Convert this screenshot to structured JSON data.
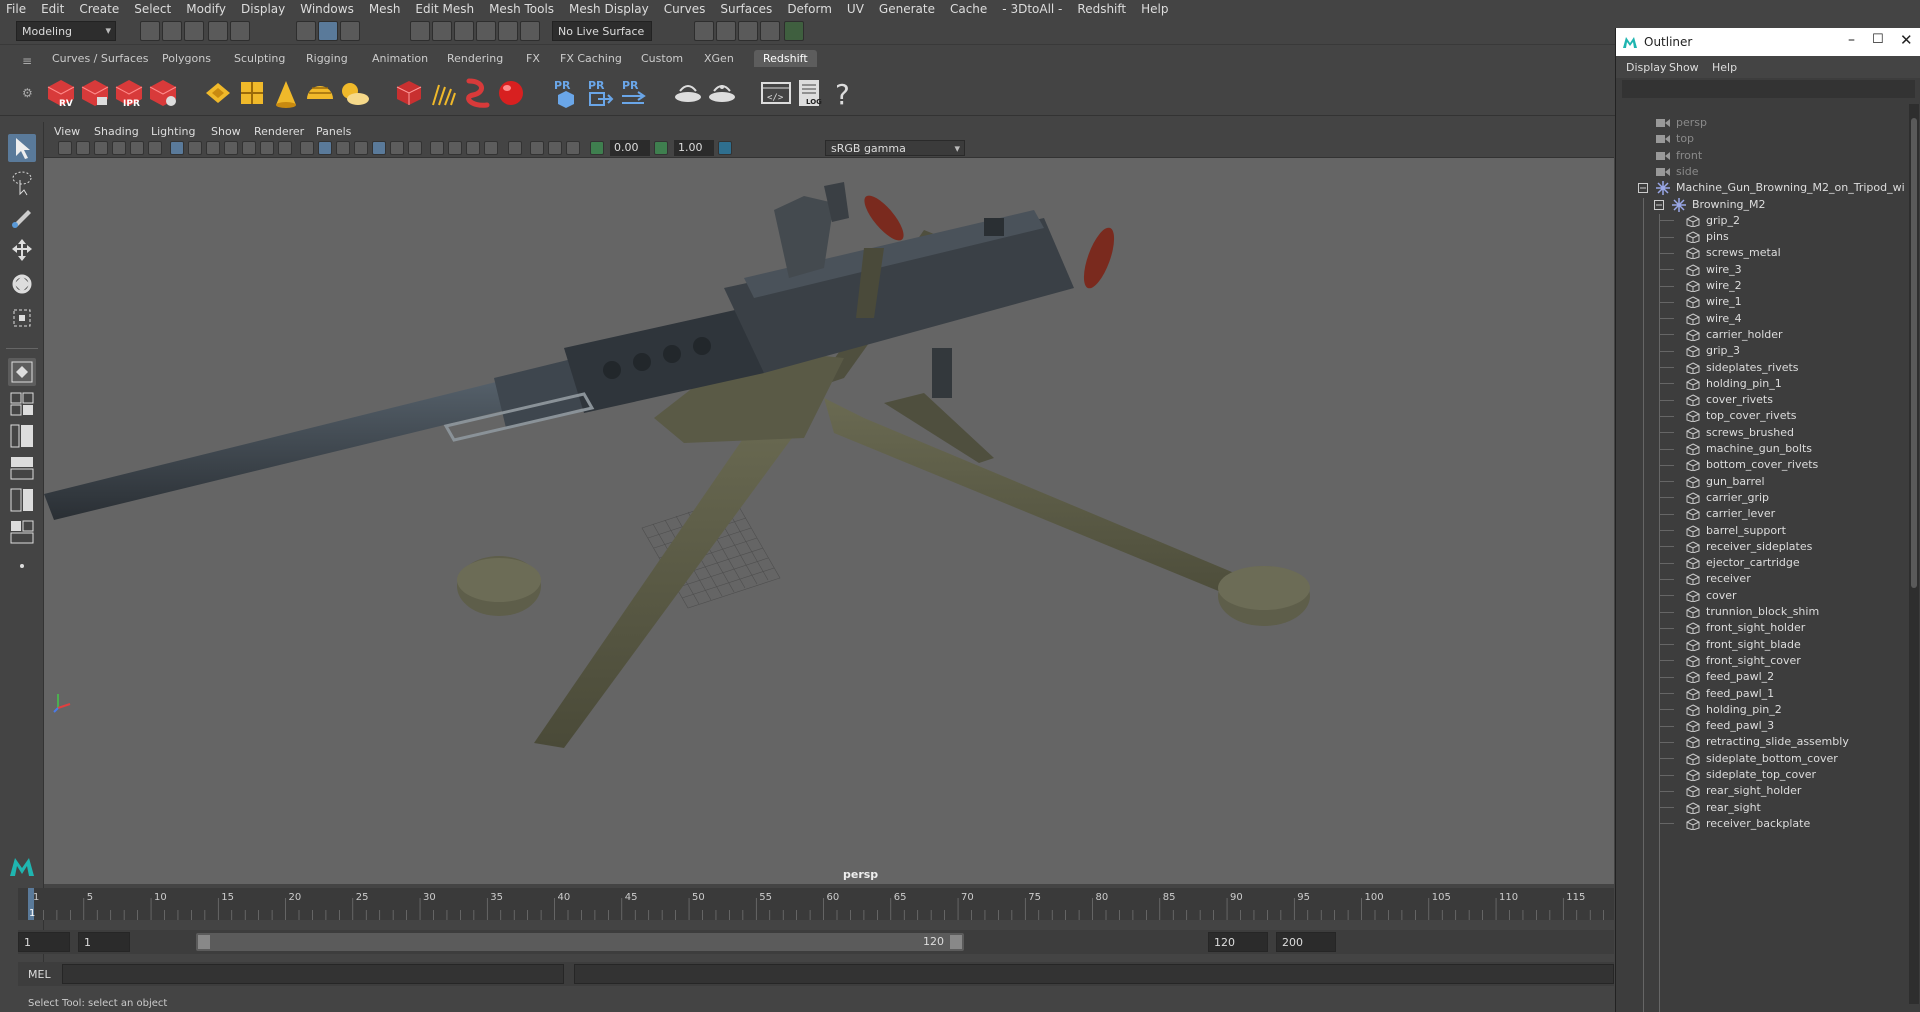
{
  "menubar": [
    "File",
    "Edit",
    "Create",
    "Select",
    "Modify",
    "Display",
    "Windows",
    "Mesh",
    "Edit Mesh",
    "Mesh Tools",
    "Mesh Display",
    "Curves",
    "Surfaces",
    "Deform",
    "UV",
    "Generate",
    "Cache",
    "- 3DtoAll -",
    "Redshift",
    "Help"
  ],
  "toolbar": {
    "mode": "Modeling",
    "live_surface": "No Live Surface"
  },
  "shelf_tabs": [
    "Curves / Surfaces",
    "Polygons",
    "Sculpting",
    "Rigging",
    "Animation",
    "Rendering",
    "FX",
    "FX Caching",
    "Custom",
    "XGen",
    "Redshift"
  ],
  "active_shelf_tab": "Redshift",
  "shelf_icon_labels": {
    "rv": "RV",
    "ipr": "IPR",
    "pr": "PR",
    "log": "LOG"
  },
  "viewport": {
    "menu": [
      "View",
      "Shading",
      "Lighting",
      "Show",
      "Renderer",
      "Panels"
    ],
    "exposure": "0.00",
    "gamma_value": "1.00",
    "color_space": "sRGB gamma",
    "camera_label": "persp"
  },
  "timeline": {
    "ticks": [
      "1",
      "5",
      "10",
      "15",
      "20",
      "25",
      "30",
      "35",
      "40",
      "45",
      "50",
      "55",
      "60",
      "65",
      "70",
      "75",
      "80",
      "85",
      "90",
      "95",
      "100",
      "105",
      "110",
      "115"
    ],
    "current_frame": "1"
  },
  "range": {
    "start": "1",
    "inner_start": "1",
    "bar_start": "1",
    "bar_end": "120",
    "end": "120",
    "max_end": "200"
  },
  "command_line": {
    "label": "MEL"
  },
  "status_line": "Select Tool: select an object",
  "outliner": {
    "title": "Outliner",
    "menu": [
      "Display",
      "Show",
      "Help"
    ],
    "cameras": [
      "persp",
      "top",
      "front",
      "side"
    ],
    "root": "Machine_Gun_Browning_M2_on_Tripod_wi",
    "group": "Browning_M2",
    "children": [
      "grip_2",
      "pins",
      "screws_metal",
      "wire_3",
      "wire_2",
      "wire_1",
      "wire_4",
      "carrier_holder",
      "grip_3",
      "sideplates_rivets",
      "holding_pin_1",
      "cover_rivets",
      "top_cover_rivets",
      "screws_brushed",
      "machine_gun_bolts",
      "bottom_cover_rivets",
      "gun_barrel",
      "carrier_grip",
      "carrier_lever",
      "barrel_support",
      "receiver_sideplates",
      "ejector_cartridge",
      "receiver",
      "cover",
      "trunnion_block_shim",
      "front_sight_holder",
      "front_sight_blade",
      "front_sight_cover",
      "feed_pawl_2",
      "feed_pawl_1",
      "holding_pin_2",
      "feed_pawl_3",
      "retracting_slide_assembly",
      "sideplate_bottom_cover",
      "sideplate_top_cover",
      "rear_sight_holder",
      "rear_sight",
      "receiver_backplate"
    ]
  },
  "colors": {
    "accent": "#5d7fa6",
    "redshift_red": "#d83a3a",
    "gun_metal": "#3a3f44",
    "tripod_olive": "#5a5a46"
  }
}
